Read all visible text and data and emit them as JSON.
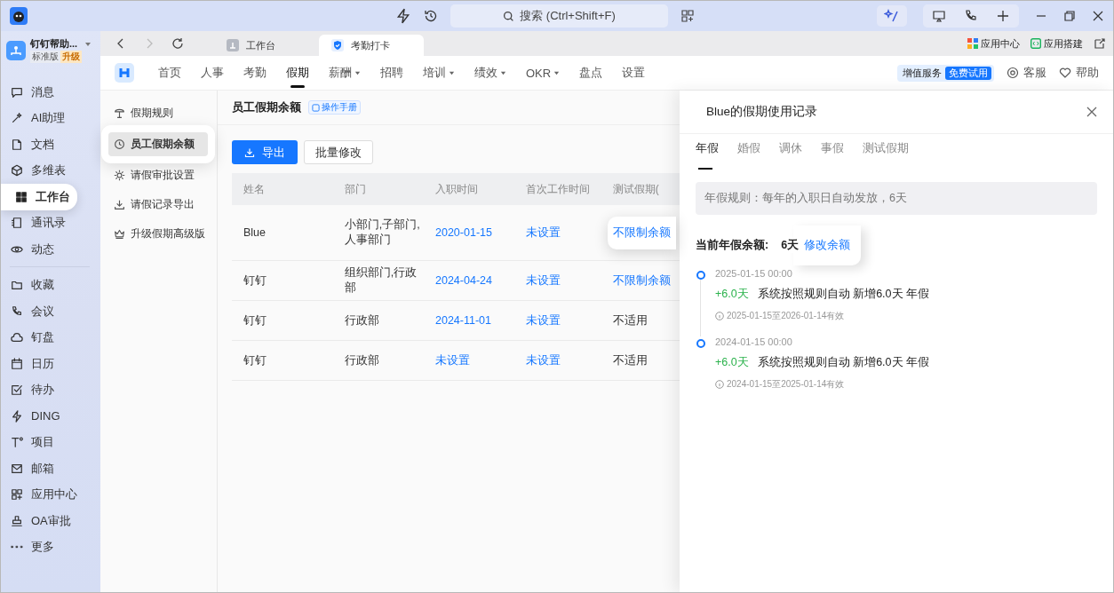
{
  "titlebar": {
    "search": {
      "placeholder": "搜索 (Ctrl+Shift+F)"
    }
  },
  "org": {
    "name": "钉钉帮助...",
    "edition": "标准版",
    "upgrade": "升级"
  },
  "sidebar": {
    "groups": [
      {
        "items": [
          {
            "label": "消息",
            "selected": false,
            "highlighted": false
          },
          {
            "label": "AI助理",
            "selected": false,
            "highlighted": false
          },
          {
            "label": "文档",
            "selected": false,
            "highlighted": false
          },
          {
            "label": "多维表",
            "selected": false,
            "highlighted": false
          },
          {
            "label": "工作台",
            "selected": true,
            "highlighted": true
          },
          {
            "label": "通讯录",
            "selected": false,
            "highlighted": false
          },
          {
            "label": "动态",
            "selected": false,
            "highlighted": false
          }
        ]
      },
      {
        "items": [
          {
            "label": "收藏",
            "selected": false,
            "highlighted": false
          },
          {
            "label": "会议",
            "selected": false,
            "highlighted": false
          },
          {
            "label": "钉盘",
            "selected": false,
            "highlighted": false
          },
          {
            "label": "日历",
            "selected": false,
            "highlighted": false
          },
          {
            "label": "待办",
            "selected": false,
            "highlighted": false
          },
          {
            "label": "DING",
            "selected": false,
            "highlighted": false
          },
          {
            "label": "项目",
            "selected": false,
            "highlighted": false
          },
          {
            "label": "邮箱",
            "selected": false,
            "highlighted": false
          },
          {
            "label": "应用中心",
            "selected": false,
            "highlighted": false
          },
          {
            "label": "OA审批",
            "selected": false,
            "highlighted": false
          },
          {
            "label": "更多",
            "selected": false,
            "highlighted": false
          }
        ]
      }
    ]
  },
  "tabs": [
    {
      "label": "工作台",
      "selected": false
    },
    {
      "label": "考勤打卡",
      "selected": true
    }
  ],
  "toolbar_links": [
    "应用中心",
    "应用搭建"
  ],
  "nav": {
    "items": [
      {
        "label": "首页",
        "selected": false,
        "dropdown": false
      },
      {
        "label": "人事",
        "selected": false,
        "dropdown": false
      },
      {
        "label": "考勤",
        "selected": false,
        "dropdown": false
      },
      {
        "label": "假期",
        "selected": true,
        "dropdown": false
      },
      {
        "label": "薪酬",
        "selected": false,
        "dropdown": true
      },
      {
        "label": "招聘",
        "selected": false,
        "dropdown": false
      },
      {
        "label": "培训",
        "selected": false,
        "dropdown": true
      },
      {
        "label": "绩效",
        "selected": false,
        "dropdown": true
      },
      {
        "label": "OKR",
        "selected": false,
        "dropdown": true
      },
      {
        "label": "盘点",
        "selected": false,
        "dropdown": false
      },
      {
        "label": "设置",
        "selected": false,
        "dropdown": false
      }
    ]
  },
  "nav_right": {
    "service": "增值服务",
    "trial": "免费试用",
    "support": "客服",
    "help": "帮助"
  },
  "submenu": {
    "items": [
      {
        "label": "假期规则",
        "selected": false,
        "highlighted": false
      },
      {
        "label": "员工假期余额",
        "selected": true,
        "highlighted": true
      },
      {
        "label": "请假审批设置",
        "selected": false,
        "highlighted": false
      },
      {
        "label": "请假记录导出",
        "selected": false,
        "highlighted": false
      },
      {
        "label": "升级假期高级版",
        "selected": false,
        "highlighted": false
      }
    ]
  },
  "page": {
    "title": "员工假期余额",
    "manual": "操作手册",
    "buttons": [
      {
        "label": "导出",
        "kind": "primary"
      },
      {
        "label": "批量修改",
        "kind": "default"
      }
    ]
  },
  "table": {
    "columns": [
      "姓名",
      "部门",
      "入职时间",
      "首次工作时间",
      "测试假期("
    ],
    "rows": [
      {
        "cells": [
          {
            "text": "Blue",
            "kind": "text",
            "highlighted": false
          },
          {
            "text": "小部门,子部门,人事部门",
            "kind": "text",
            "highlighted": false
          },
          {
            "text": "2020-01-15",
            "kind": "link",
            "highlighted": false
          },
          {
            "text": "未设置",
            "kind": "link",
            "highlighted": false
          },
          {
            "text": "不限制余额",
            "kind": "link",
            "highlighted": true
          }
        ]
      },
      {
        "cells": [
          {
            "text": "钉钉",
            "kind": "text",
            "highlighted": false
          },
          {
            "text": "组织部门,行政部",
            "kind": "text",
            "highlighted": false
          },
          {
            "text": "2024-04-24",
            "kind": "link",
            "highlighted": false
          },
          {
            "text": "未设置",
            "kind": "link",
            "highlighted": false
          },
          {
            "text": "不限制余额",
            "kind": "link",
            "highlighted": false
          }
        ]
      },
      {
        "cells": [
          {
            "text": "钉钉",
            "kind": "text",
            "highlighted": false
          },
          {
            "text": "行政部",
            "kind": "text",
            "highlighted": false
          },
          {
            "text": "2024-11-01",
            "kind": "link",
            "highlighted": false
          },
          {
            "text": "未设置",
            "kind": "link",
            "highlighted": false
          },
          {
            "text": "不适用",
            "kind": "text",
            "highlighted": false
          }
        ]
      },
      {
        "cells": [
          {
            "text": "钉钉",
            "kind": "text",
            "highlighted": false
          },
          {
            "text": "行政部",
            "kind": "text",
            "highlighted": false
          },
          {
            "text": "未设置",
            "kind": "link",
            "highlighted": false
          },
          {
            "text": "未设置",
            "kind": "link",
            "highlighted": false
          },
          {
            "text": "不适用",
            "kind": "text",
            "highlighted": false
          }
        ]
      }
    ]
  },
  "drawer": {
    "title": "Blue的假期使用记录",
    "tabs": [
      {
        "label": "年假",
        "selected": true
      },
      {
        "label": "婚假",
        "selected": false
      },
      {
        "label": "调休",
        "selected": false
      },
      {
        "label": "事假",
        "selected": false
      },
      {
        "label": "测试假期",
        "selected": false
      }
    ],
    "rule": "年假规则：每年的入职日自动发放，6天",
    "balance_label": "当前年假余额:",
    "balance_value": "6天",
    "edit_link": {
      "label": "修改余额",
      "highlighted": true
    },
    "timeline": [
      {
        "time": "2025-01-15 00:00",
        "amount": "+6.0天",
        "description": "系统按照规则自动 新增6.0天 年假",
        "validity": "2025-01-15至2026-01-14有效"
      },
      {
        "time": "2024-01-15 00:00",
        "amount": "+6.0天",
        "description": "系统按照规则自动 新增6.0天 年假",
        "validity": "2024-01-15至2025-01-14有效"
      }
    ]
  }
}
